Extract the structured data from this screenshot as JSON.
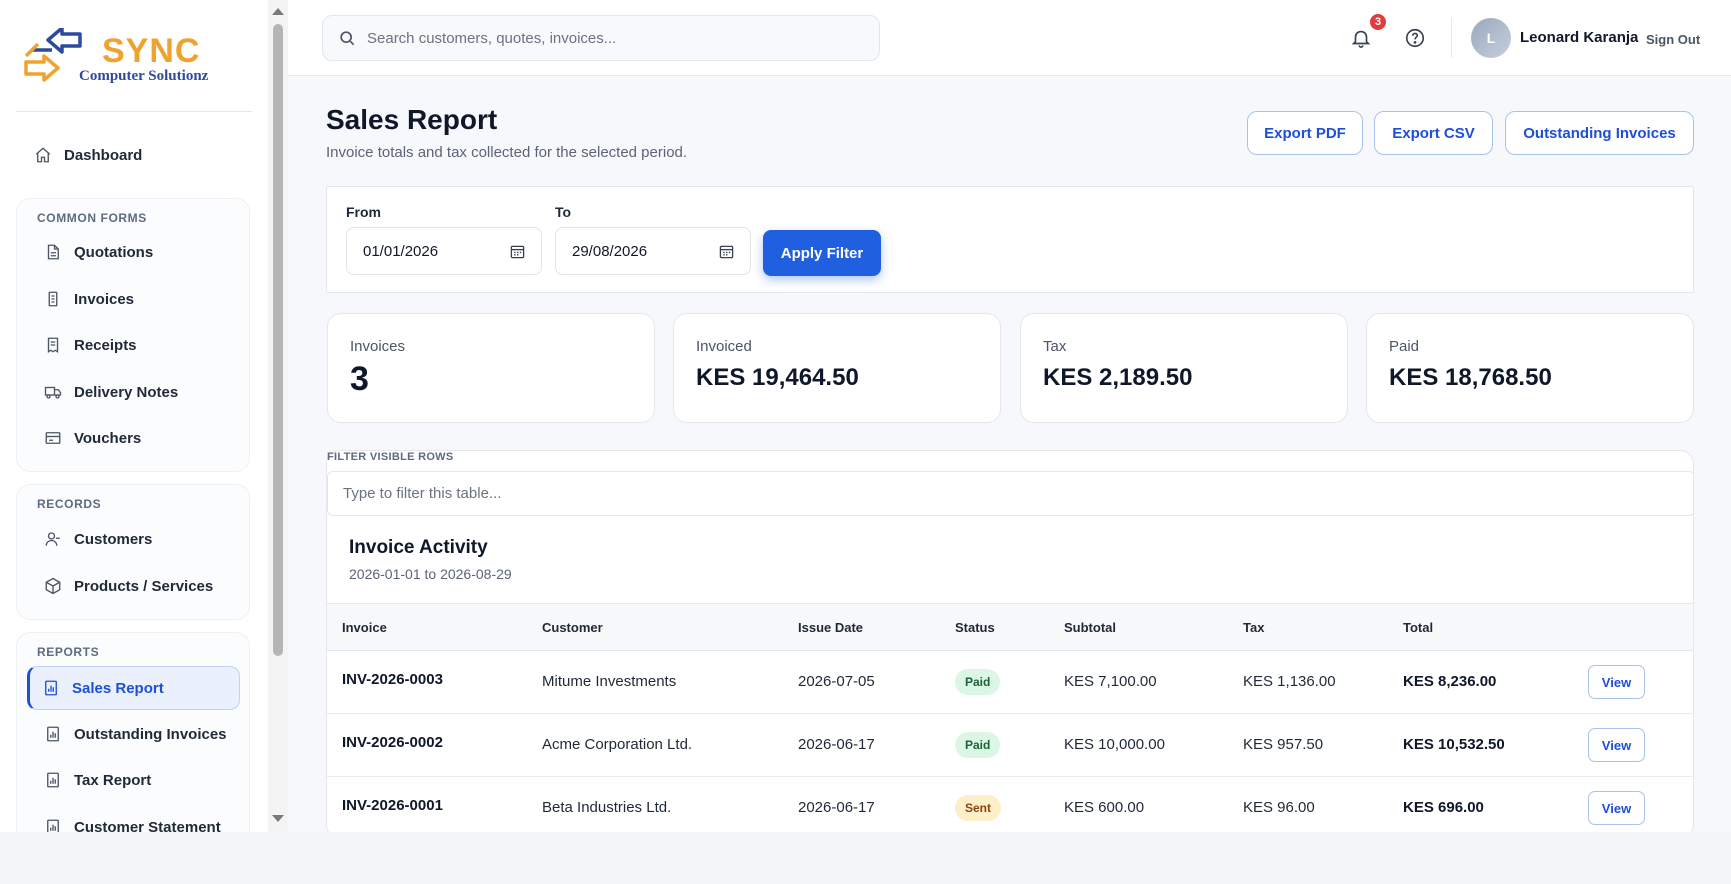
{
  "brand": {
    "name": "SYNC",
    "tagline": "Computer Solutionz",
    "colors": {
      "orange": "#f0a22e",
      "blue": "#2f4a9a"
    }
  },
  "sidebar": {
    "dashboard": {
      "label": "Dashboard",
      "icon": "home-icon"
    },
    "groups": [
      {
        "title": "COMMON FORMS",
        "items": [
          {
            "label": "Quotations",
            "icon": "document-icon"
          },
          {
            "label": "Invoices",
            "icon": "invoice-icon"
          },
          {
            "label": "Receipts",
            "icon": "receipt-icon"
          },
          {
            "label": "Delivery Notes",
            "icon": "truck-icon"
          },
          {
            "label": "Vouchers",
            "icon": "voucher-icon"
          }
        ]
      },
      {
        "title": "RECORDS",
        "items": [
          {
            "label": "Customers",
            "icon": "user-icon"
          },
          {
            "label": "Products / Services",
            "icon": "box-icon"
          }
        ]
      },
      {
        "title": "REPORTS",
        "items": [
          {
            "label": "Sales Report",
            "icon": "report-icon",
            "active": true
          },
          {
            "label": "Outstanding Invoices",
            "icon": "report-icon"
          },
          {
            "label": "Tax Report",
            "icon": "report-icon"
          },
          {
            "label": "Customer Statement",
            "icon": "report-icon"
          }
        ]
      }
    ]
  },
  "topbar": {
    "search_placeholder": "Search customers, quotes, invoices...",
    "notification_count": "3",
    "user_initial": "L",
    "user_name": "Leonard Karanja",
    "sign_out": "Sign Out"
  },
  "page": {
    "title": "Sales Report",
    "subtitle": "Invoice totals and tax collected for the selected period.",
    "actions": [
      "Export PDF",
      "Export CSV",
      "Outstanding Invoices"
    ]
  },
  "filter": {
    "from_label": "From",
    "from_value": "01/01/2026",
    "to_label": "To",
    "to_value": "29/08/2026",
    "apply_label": "Apply Filter"
  },
  "stats": [
    {
      "label": "Invoices",
      "value": "3"
    },
    {
      "label": "Invoiced",
      "value": "KES 19,464.50"
    },
    {
      "label": "Tax",
      "value": "KES 2,189.50"
    },
    {
      "label": "Paid",
      "value": "KES 18,768.50"
    }
  ],
  "table": {
    "filter_label": "FILTER VISIBLE ROWS",
    "filter_placeholder": "Type to filter this table...",
    "title": "Invoice Activity",
    "range": "2026-01-01 to 2026-08-29",
    "columns": [
      "Invoice",
      "Customer",
      "Issue Date",
      "Status",
      "Subtotal",
      "Tax",
      "Total"
    ],
    "view_label": "View",
    "rows": [
      {
        "invoice": "INV-2026-0003",
        "customer": "Mitume Investments",
        "date": "2026-07-05",
        "status": "Paid",
        "subtotal": "KES 7,100.00",
        "tax": "KES 1,136.00",
        "total": "KES 8,236.00"
      },
      {
        "invoice": "INV-2026-0002",
        "customer": "Acme Corporation Ltd.",
        "date": "2026-06-17",
        "status": "Paid",
        "subtotal": "KES 10,000.00",
        "tax": "KES 957.50",
        "total": "KES 10,532.50"
      },
      {
        "invoice": "INV-2026-0001",
        "customer": "Beta Industries Ltd.",
        "date": "2026-06-17",
        "status": "Sent",
        "subtotal": "KES 600.00",
        "tax": "KES 96.00",
        "total": "KES 696.00"
      }
    ]
  }
}
